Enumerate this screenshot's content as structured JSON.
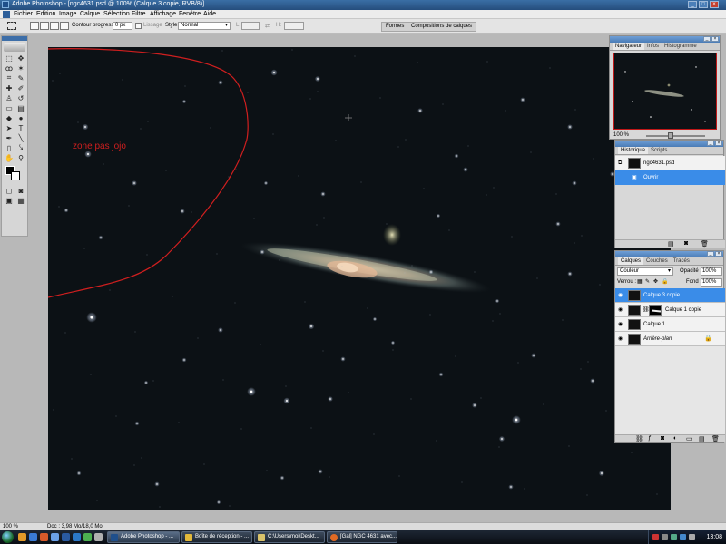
{
  "app": {
    "title": "Adobe Photoshop - [ngc4631.psd @ 100% (Calque 3 copie, RVB/8)]"
  },
  "menu": [
    "Fichier",
    "Edition",
    "Image",
    "Calque",
    "Sélection",
    "Filtre",
    "Affichage",
    "Fenêtre",
    "Aide"
  ],
  "options": {
    "contour_label": "Contour progressif :",
    "contour_value": "0 px",
    "lissage_label": "Lissage",
    "style_label": "Style:",
    "style_value": "Normal",
    "l_label": "L:",
    "h_label": "H:",
    "tab_formes": "Formes",
    "tab_compositions": "Compositions de calques"
  },
  "canvas": {
    "annotation": "zone pas jojo",
    "annotation_color": "#d01f1f",
    "background_color": "#0c1115"
  },
  "navigator": {
    "tabs": [
      "Navigateur",
      "Infos",
      "Histogramme"
    ],
    "zoom": "100 %"
  },
  "history": {
    "tabs": [
      "Historique",
      "Scripts"
    ],
    "snapshot": "ngc4631.psd",
    "state": "Ouvrir"
  },
  "layers": {
    "tabs": [
      "Calques",
      "Couches",
      "Tracés"
    ],
    "blend_mode": "Couleur",
    "opacity_label": "Opacité :",
    "opacity_value": "100%",
    "lock_label": "Verrou :",
    "fill_label": "Fond :",
    "fill_value": "100%",
    "items": [
      {
        "name": "Calque 3 copie",
        "active": true
      },
      {
        "name": "Calque 1 copie",
        "active": false
      },
      {
        "name": "Calque 1",
        "active": false
      },
      {
        "name": "Arrière-plan",
        "active": false
      }
    ]
  },
  "status": {
    "zoom": "100 %",
    "doc": "Doc : 3,98 Mo/18,0 Mo"
  },
  "taskbar": {
    "tasks": [
      "Adobe Photoshop - ...",
      "Boîte de réception - ...",
      "C:\\Users\\moi\\Deskt...",
      "[Gal] NGC 4631 avec..."
    ],
    "clock": "13:08"
  }
}
